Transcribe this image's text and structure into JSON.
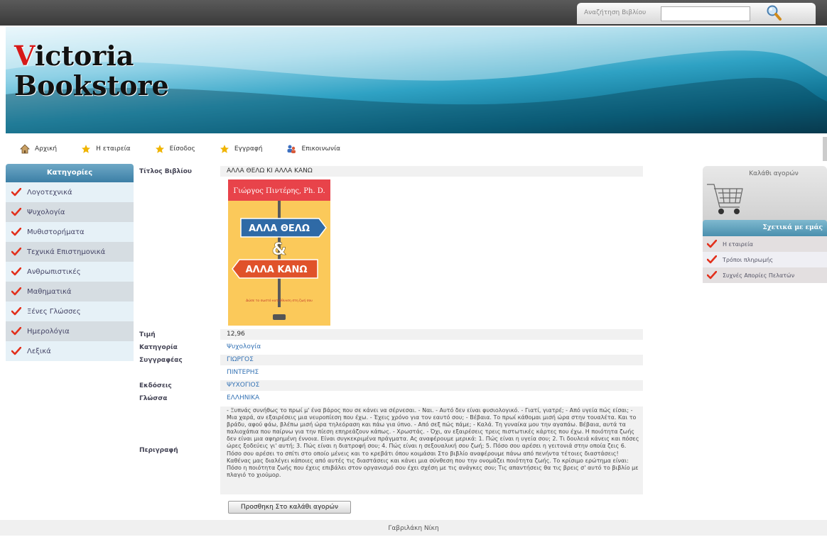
{
  "search": {
    "label": "Αναζήτηση Βιβλίου",
    "value": ""
  },
  "logo": {
    "first_letter": "V",
    "rest_line1": "ictoria",
    "line2": "Bookstore"
  },
  "nav": [
    {
      "label": "Αρχική",
      "icon": "home-icon"
    },
    {
      "label": "Η εταιρεία",
      "icon": "star-icon"
    },
    {
      "label": "Είσοδος",
      "icon": "star-icon"
    },
    {
      "label": "Εγγραφή",
      "icon": "star-icon"
    },
    {
      "label": "Επικοινωνία",
      "icon": "contact-icon"
    }
  ],
  "categories": {
    "header": "Κατηγορίες",
    "items": [
      "Λογοτεχνικά",
      "Ψυχολογία",
      "Μυθιστορήματα",
      "Τεχνικά Επιστημονικά",
      "Ανθρωπιστικές",
      "Μαθηματικά",
      "Ξένες Γλώσσες",
      "Ημερολόγια",
      "Λεξικά"
    ]
  },
  "book": {
    "title_label": "Τίτλος Βιβλίου",
    "title": "ΑΛΛΑ ΘΕΛΩ ΚΙ ΑΛΛΑ ΚΑΝΩ",
    "price_label": "Τιμή",
    "price": "12,96",
    "category_label": "Κατηγορία",
    "category": "Ψυχολογία",
    "author_label": "Συγγραφέας",
    "author_first": "ΓΙΩΡΓΟΣ",
    "author_last": "ΠΙΝΤΕΡΗΣ",
    "publisher_label": "Εκδόσεις",
    "publisher": "ΨΥΧΟΓΙΟΣ",
    "language_label": "Γλώσσα",
    "language": "ΕΛΛΗΝΙΚΑ",
    "description_label": "Περιγραφή",
    "description": "- Ξυπνάς συνήθως το πρωί μ' ένα βάρος που σε κάνει να σέρνεσαι. - Ναι. - Αυτό δεν είναι φυσιολογικό. - Γιατί, γιατρέ; - Από υγεία πώς είσαι; - Μια χαρά, αν εξαιρέσεις μια νευροπίεση που έχω. - Έχεις χρόνο για τον εαυτό σου; - Βέβαια. Το πρωί κάθομαι μισή ώρα στην τουαλέτα. Και το βράδυ, αφού φάω, βλέπω μισή ώρα τηλεόραση και πάω για ύπνο. - Από σεξ πώς πάμε; - Καλά. Τη γυναίκα μου την αγαπάω. Βέβαια, αυτά τα παλιοχάπια που παίρνω για την πίεση επηρεάζουν κάπως. - Χρωστάς. - Όχι, αν εξαιρέσεις τρεις πιστωτικές κάρτες που έχω. Η ποιότητα ζωής δεν είναι μια αφηρημένη έννοια. Είναι συγκεκριμένα πράγματα. Ας αναφέρουμε μερικά: 1. Πώς είναι η υγεία σου; 2. Τι δουλειά κάνεις και πόσες ώρες ξοδεύεις γι' αυτή; 3. Πώς είναι η διατροφή σου; 4. Πώς είναι η σεξουαλική σου ζωή; 5. Πόσο σου αρέσει η γειτονιά στην οποία ζεις 6. Πόσο σου αρέσει το σπίτι στο οποίο μένεις και το κρεβάτι όπου κοιμάσαι Στο βιβλίο αναφέρουμε πάνω από πενήντα τέτοιες διαστάσεις! Καθένας μας διαλέγει κάποιες από αυτές τις διαστάσεις και κάνει μια σύνθεση που την ονομάζει ποιότητα ζωής. Το κρίσιμο ερώτημα είναι: Πόσο η ποιότητα ζωής που έχεις επιβάλει στον οργανισμό σου έχει σχέση με τις ανάγκες σου; Τις απαντήσεις θα τις βρεις σ' αυτό το βιβλίο με πλαγιό το χιούμορ.",
    "add_to_cart": "Προσθηκη Στο καλάθι αγορών"
  },
  "cover": {
    "author": "Γιώργος Πιντέρης, Ph. D.",
    "line1": "ΑΛΛΑ ΘΕΛΩ",
    "amp": "&",
    "line2": "ΑΛΛΑ ΚΑΝΩ",
    "subtitle": "Δώσε το σωστό κατεύθυνση στη ζωή σου"
  },
  "cart": {
    "title": "Καλάθι αγορών"
  },
  "about": {
    "header": "Σχετικά με εμάς",
    "items": [
      "Η εταιρεία",
      "Τρόποι πληρωμής",
      "Συχνές Απορίες Πελατών"
    ]
  },
  "footer": {
    "text": "Γαβριλάκη Νίκη"
  },
  "colors": {
    "checkmark": "#e2301c",
    "star": "#f0b400",
    "link": "#3573b5",
    "accent": "#3c7fa6"
  }
}
